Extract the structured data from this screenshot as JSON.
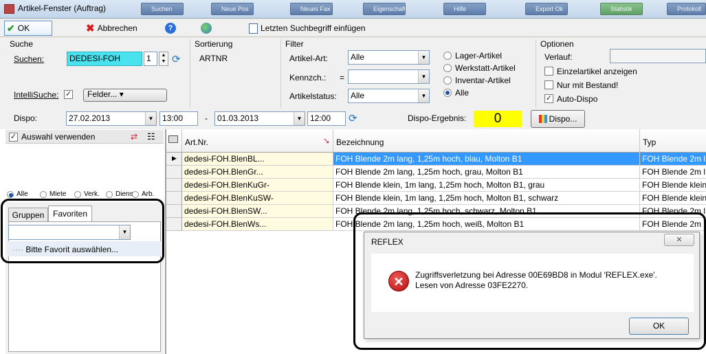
{
  "window": {
    "title": "Artikel-Fenster (Auftrag)"
  },
  "taskbar": [
    "Suchen",
    "Neue Pos",
    "Neues Fax",
    "Eigenschaften",
    "Hilfe",
    "Export Ok",
    "Statistik",
    "Protokoll"
  ],
  "toolbar": {
    "ok": "OK",
    "cancel": "Abbrechen",
    "paste_search": "Letzten Suchbegriff einfügen"
  },
  "suche": {
    "section": "Suche",
    "label": "Suchen:",
    "value": "DEDESI-FOH",
    "count": "1",
    "intelli_label": "IntelliSuche:",
    "felder": "Felder... ▾"
  },
  "sortierung": {
    "section": "Sortierung",
    "value": "ARTNR"
  },
  "filter": {
    "section": "Filter",
    "artikelart_label": "Artikel-Art:",
    "artikelart": "Alle",
    "kennz_label": "Kennzch.:",
    "kennz_op": "=",
    "kennz": "",
    "status_label": "Artikelstatus:",
    "status": "Alle",
    "radios": [
      "Lager-Artikel",
      "Werkstatt-Artikel",
      "Inventar-Artikel",
      "Alle"
    ]
  },
  "optionen": {
    "section": "Optionen",
    "verlauf_label": "Verlauf:",
    "checks": [
      {
        "label": "Einzelartikel anzeigen",
        "checked": false
      },
      {
        "label": "Nur mit Bestand!",
        "checked": false
      },
      {
        "label": "Auto-Dispo",
        "checked": true
      }
    ]
  },
  "dispo": {
    "label": "Dispo:",
    "from_date": "27.02.2013",
    "from_time": "13:00",
    "dash": "-",
    "to_date": "01.03.2013",
    "to_time": "12:00",
    "result_label": "Dispo-Ergebnis:",
    "result": "0",
    "button": "Dispo..."
  },
  "left": {
    "auswahl": "Auswahl verwenden",
    "radios": [
      "Alle",
      "Miete",
      "Verk.",
      "Diens",
      "Arb."
    ],
    "tabs": [
      "Gruppen",
      "Favoriten"
    ],
    "tree_item": "Bitte Favorit auswählen..."
  },
  "grid": {
    "columns": [
      "Art.Nr.",
      "Bezeichnung",
      "Typ"
    ],
    "rows": [
      [
        "dedesi-FOH.BlenBL...",
        "FOH Blende 2m lang, 1,25m hoch, blau, Molton B1",
        "FOH Blende 2m l"
      ],
      [
        "dedesi-FOH.BlenGr...",
        "FOH Blende 2m lang, 1,25m hoch, grau, Molton B1",
        "FOH Blende 2m l"
      ],
      [
        "dedesi-FOH.BlenKuGr-",
        "FOH Blende klein, 1m lang, 1,25m hoch, Molton B1, grau",
        "FOH Blende klein"
      ],
      [
        "dedesi-FOH.BlenKuSW-",
        "FOH Blende klein, 1m lang, 1,25m hoch, Molton B1, schwarz",
        "FOH Blende klein"
      ],
      [
        "dedesi-FOH.BlenSW...",
        "FOH Blende 2m lang, 1,25m hoch, schwarz, Molton B1",
        "FOH Blende 2m l"
      ],
      [
        "dedesi-FOH.BlenWs...",
        "FOH Blende 2m lang, 1,25m hoch, weiß, Molton B1",
        "FOH Blende 2m l"
      ]
    ]
  },
  "dialog": {
    "title": "REFLEX",
    "message": "Zugriffsverletzung bei Adresse 00E69BD8 in Modul 'REFLEX.exe'. Lesen von Adresse 03FE2270.",
    "ok": "OK"
  }
}
